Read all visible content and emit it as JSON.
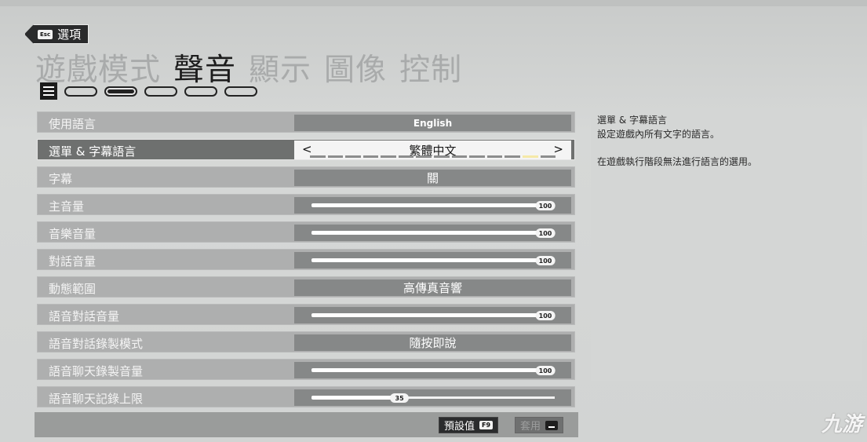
{
  "header": {
    "back_key": "Esc",
    "back_label": "選項",
    "tabs": [
      "遊戲模式",
      "聲音",
      "顯示",
      "圖像",
      "控制"
    ]
  },
  "settings": [
    {
      "name": "使用語言",
      "value": "English"
    },
    {
      "name": "選單 & 字幕語言",
      "value": "繁體中文",
      "left_arrow": "<",
      "right_arrow": ">"
    },
    {
      "name": "字幕",
      "value": "關"
    },
    {
      "name": "主音量",
      "value": "100",
      "level": 1.0
    },
    {
      "name": "音樂音量",
      "value": "100",
      "level": 1.0
    },
    {
      "name": "對話音量",
      "value": "100",
      "level": 1.0
    },
    {
      "name": "動態範圍",
      "value": "高傳真音響"
    },
    {
      "name": "語音對話音量",
      "value": "100",
      "level": 1.0
    },
    {
      "name": "語音對話錄製模式",
      "value": "隨按即說"
    },
    {
      "name": "語音聊天錄製音量",
      "value": "100",
      "level": 1.0
    },
    {
      "name": "語音聊天記錄上限",
      "value": "35",
      "level": 0.35
    }
  ],
  "footer": {
    "default_label": "預設值",
    "default_key": "F9",
    "apply_label": "套用"
  },
  "description": {
    "title": "選單 & 字幕語言",
    "line1": "設定遊戲內所有文字的語言。",
    "line2": "在遊戲執行階段無法進行語言的選用。"
  },
  "watermark": "九游",
  "colors": {
    "selected_row": "#6e706f",
    "value_box": "#868888",
    "active_tab": "#1d1d1d",
    "inactive_tab": "#a9abab"
  }
}
